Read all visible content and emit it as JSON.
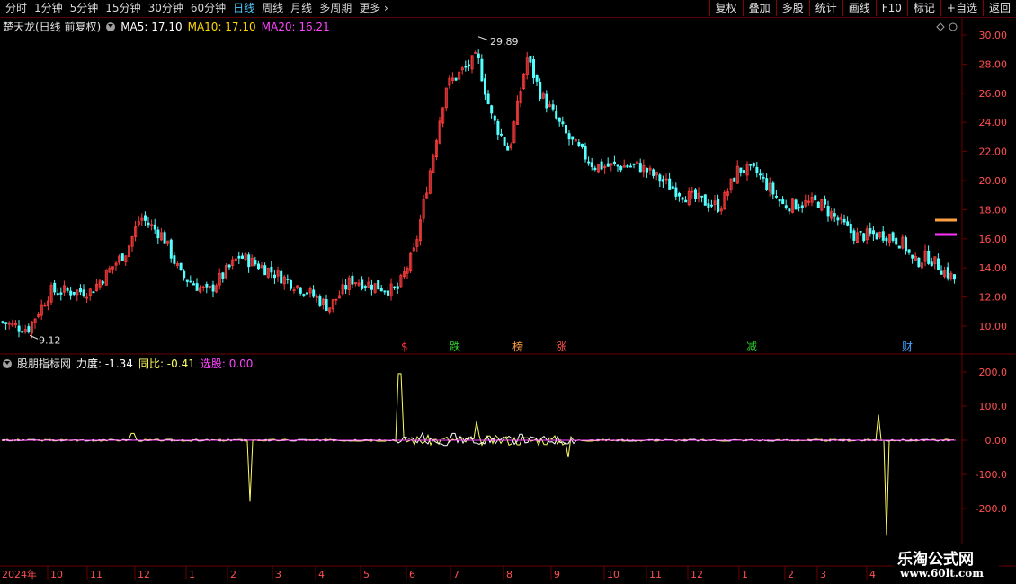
{
  "toolbar": {
    "tabs": [
      "分时",
      "1分钟",
      "5分钟",
      "15分钟",
      "30分钟",
      "60分钟",
      "日线",
      "周线",
      "月线",
      "多周期",
      "更多"
    ],
    "active_tab": "日线",
    "right_buttons": [
      "复权",
      "叠加",
      "多股",
      "统计",
      "画线",
      "F10",
      "标记",
      "+自选",
      "返回"
    ]
  },
  "price_panel": {
    "stock_title": "楚天龙(日线 前复权)",
    "ma5": "MA5: 17.10",
    "ma10": "MA10: 17.10",
    "ma20": "MA20: 16.21",
    "high_label": "29.89",
    "low_label": "9.12",
    "y_ticks": [
      "30.00",
      "28.00",
      "26.00",
      "24.00",
      "22.00",
      "20.00",
      "18.00",
      "16.00",
      "14.00",
      "12.00",
      "10.00"
    ],
    "event_markers": [
      "$",
      "跌",
      "榜",
      "涨",
      "减",
      "财"
    ],
    "colors": {
      "up": "#ff3c3c",
      "down": "#54ffff",
      "ma5": "#ffffff",
      "ma10": "#ffd700",
      "ma20": "#ff44ff",
      "grid": "#6b0000"
    }
  },
  "indicator_panel": {
    "name": "股朋指标网",
    "lidu": "力度: -1.34",
    "tongbi": "同比: -0.41",
    "xuangu": "选股: 0.00",
    "y_ticks": [
      "200.0",
      "100.0",
      "0.00",
      "-100.0",
      "-200.0"
    ]
  },
  "time_axis": {
    "labels": [
      "2024年",
      "10",
      "11",
      "12",
      "1",
      "2",
      "3",
      "4",
      "5",
      "6",
      "7",
      "8",
      "9",
      "10",
      "11",
      "12",
      "1",
      "2",
      "3",
      "4"
    ]
  },
  "watermark": {
    "line1": "乐淘公式网",
    "line2": "www.60lt.com"
  }
}
